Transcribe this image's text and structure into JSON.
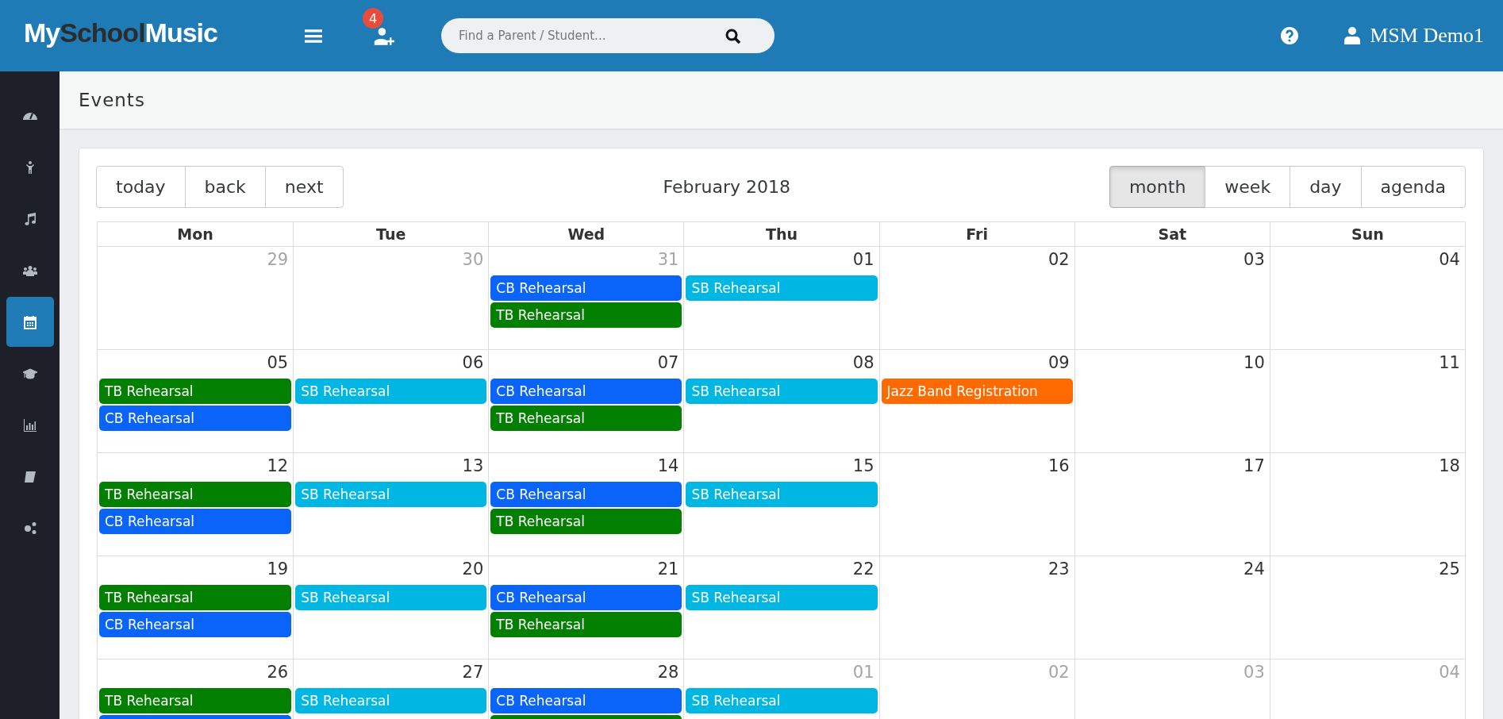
{
  "header": {
    "logo_left": "My",
    "logo_mid": "School",
    "logo_right": "Music",
    "notification_count": "4",
    "search": {
      "placeholder": "Find a Parent / Student..."
    },
    "user": "MSM Demo1"
  },
  "sidebar": {
    "items": [
      {
        "selected": false
      },
      {
        "selected": false
      },
      {
        "selected": false
      },
      {
        "selected": false
      },
      {
        "selected": true
      },
      {
        "selected": false
      },
      {
        "selected": false
      },
      {
        "selected": false
      },
      {
        "selected": false
      }
    ]
  },
  "page_title": "Events",
  "toolbar": {
    "nav_buttons": [
      "today",
      "back",
      "next"
    ],
    "label": "February 2018",
    "views": [
      {
        "label": "month",
        "selected": true
      },
      {
        "label": "week",
        "selected": false
      },
      {
        "label": "day",
        "selected": false
      },
      {
        "label": "agenda",
        "selected": false
      }
    ]
  },
  "weekdays": [
    "Mon",
    "Tue",
    "Wed",
    "Thu",
    "Fri",
    "Sat",
    "Sun"
  ],
  "weeks": [
    [
      {
        "date": "29",
        "off_month": true
      },
      {
        "date": "30",
        "off_month": true
      },
      {
        "date": "31",
        "off_month": true,
        "events": [
          {
            "label": "CB Rehearsal",
            "color": "#0a64fa"
          },
          {
            "label": "TB Rehearsal",
            "color": "#037f02"
          }
        ]
      },
      {
        "date": "01",
        "off_month": false,
        "events": [
          {
            "label": "SB Rehearsal",
            "color": "#00b7e3"
          }
        ]
      },
      {
        "date": "02",
        "off_month": false
      },
      {
        "date": "03",
        "off_month": false
      },
      {
        "date": "04",
        "off_month": false
      }
    ],
    [
      {
        "date": "05",
        "off_month": false,
        "events": [
          {
            "label": "TB Rehearsal",
            "color": "#037f02"
          },
          {
            "label": "CB Rehearsal",
            "color": "#0a64fa"
          }
        ]
      },
      {
        "date": "06",
        "off_month": false,
        "events": [
          {
            "label": "SB Rehearsal",
            "color": "#00b7e3"
          }
        ]
      },
      {
        "date": "07",
        "off_month": false,
        "events": [
          {
            "label": "CB Rehearsal",
            "color": "#0a64fa"
          },
          {
            "label": "TB Rehearsal",
            "color": "#037f02"
          }
        ]
      },
      {
        "date": "08",
        "off_month": false,
        "events": [
          {
            "label": "SB Rehearsal",
            "color": "#00b7e3"
          }
        ]
      },
      {
        "date": "09",
        "off_month": false,
        "events": [
          {
            "label": "Jazz Band Registration",
            "color": "#ff6a00"
          }
        ]
      },
      {
        "date": "10",
        "off_month": false
      },
      {
        "date": "11",
        "off_month": false
      }
    ],
    [
      {
        "date": "12",
        "off_month": false,
        "events": [
          {
            "label": "TB Rehearsal",
            "color": "#037f02"
          },
          {
            "label": "CB Rehearsal",
            "color": "#0a64fa"
          }
        ]
      },
      {
        "date": "13",
        "off_month": false,
        "events": [
          {
            "label": "SB Rehearsal",
            "color": "#00b7e3"
          }
        ]
      },
      {
        "date": "14",
        "off_month": false,
        "events": [
          {
            "label": "CB Rehearsal",
            "color": "#0a64fa"
          },
          {
            "label": "TB Rehearsal",
            "color": "#037f02"
          }
        ]
      },
      {
        "date": "15",
        "off_month": false,
        "events": [
          {
            "label": "SB Rehearsal",
            "color": "#00b7e3"
          }
        ]
      },
      {
        "date": "16",
        "off_month": false
      },
      {
        "date": "17",
        "off_month": false
      },
      {
        "date": "18",
        "off_month": false
      }
    ],
    [
      {
        "date": "19",
        "off_month": false,
        "events": [
          {
            "label": "TB Rehearsal",
            "color": "#037f02"
          },
          {
            "label": "CB Rehearsal",
            "color": "#0a64fa"
          }
        ]
      },
      {
        "date": "20",
        "off_month": false,
        "events": [
          {
            "label": "SB Rehearsal",
            "color": "#00b7e3"
          }
        ]
      },
      {
        "date": "21",
        "off_month": false,
        "events": [
          {
            "label": "CB Rehearsal",
            "color": "#0a64fa"
          },
          {
            "label": "TB Rehearsal",
            "color": "#037f02"
          }
        ]
      },
      {
        "date": "22",
        "off_month": false,
        "events": [
          {
            "label": "SB Rehearsal",
            "color": "#00b7e3"
          }
        ]
      },
      {
        "date": "23",
        "off_month": false
      },
      {
        "date": "24",
        "off_month": false
      },
      {
        "date": "25",
        "off_month": false
      }
    ],
    [
      {
        "date": "26",
        "off_month": false,
        "events": [
          {
            "label": "TB Rehearsal",
            "color": "#037f02"
          },
          {
            "color": "#0a64fa"
          }
        ]
      },
      {
        "date": "27",
        "off_month": false,
        "events": [
          {
            "label": "SB Rehearsal",
            "color": "#00b7e3"
          }
        ]
      },
      {
        "date": "28",
        "off_month": false,
        "events": [
          {
            "label": "CB Rehearsal",
            "color": "#0a64fa"
          },
          {
            "color": "#037f02"
          }
        ]
      },
      {
        "date": "01",
        "off_month": true,
        "events": [
          {
            "label": "SB Rehearsal",
            "color": "#00b7e3"
          }
        ]
      },
      {
        "date": "02",
        "off_month": true
      },
      {
        "date": "03",
        "off_month": true
      },
      {
        "date": "04",
        "off_month": true
      }
    ]
  ]
}
